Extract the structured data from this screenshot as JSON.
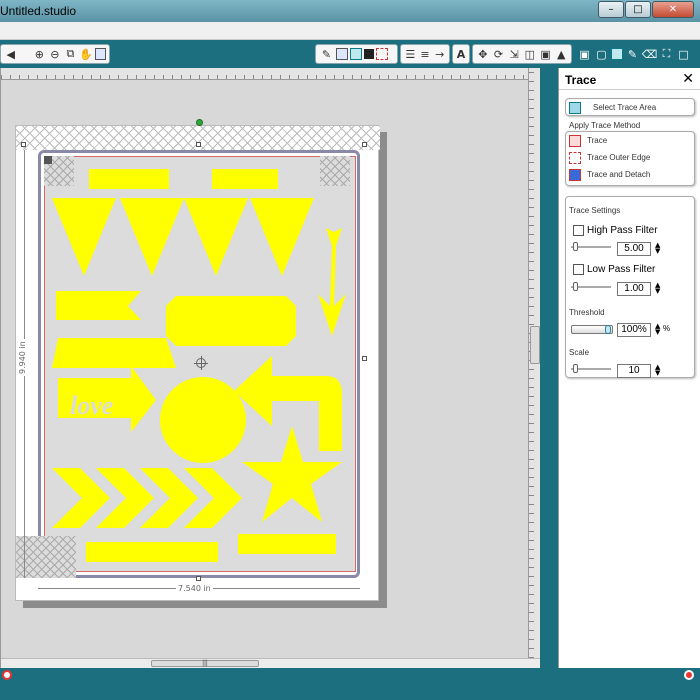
{
  "window": {
    "title": "Untitled.studio",
    "minimize": "–",
    "maximize": "□",
    "close": "✕"
  },
  "canvas": {
    "width_label": "7.540 in",
    "height_label": "9.940 in",
    "shape_color": "#ffff00",
    "love_text": "love"
  },
  "panel": {
    "title": "Trace",
    "close": "✕",
    "select_trace_area": "Select Trace Area",
    "apply_trace_method": "Apply Trace Method",
    "methods": [
      "Trace",
      "Trace Outer Edge",
      "Trace and Detach"
    ],
    "trace_settings": "Trace Settings",
    "high_pass_filter": {
      "label": "High Pass Filter",
      "value": "5.00"
    },
    "low_pass_filter": {
      "label": "Low Pass Filter",
      "value": "1.00"
    },
    "threshold": {
      "label": "Threshold",
      "value": "100%",
      "unit": "%"
    },
    "scale": {
      "label": "Scale",
      "value": "10"
    }
  },
  "colors": {
    "accent": "#1c6f7e",
    "title_gradient_top": "#7fb6c6",
    "close_red": "#c44b33"
  },
  "toolbar_icons": [
    "search-icon",
    "zoom-out-icon",
    "zoom-fit-icon",
    "hand-icon",
    "page-icon",
    "fill-icon",
    "grid-icon",
    "black-box-icon",
    "dashed-box-icon",
    "lines-icon",
    "dash-lines-icon",
    "knife-icon",
    "text-icon",
    "move-icon",
    "rotate-icon",
    "flip-icon",
    "align-icon",
    "scale-icon",
    "send-icon",
    "replicate-icon",
    "trace-icon",
    "pencil-icon",
    "eraser-icon",
    "fullscreen-icon"
  ]
}
